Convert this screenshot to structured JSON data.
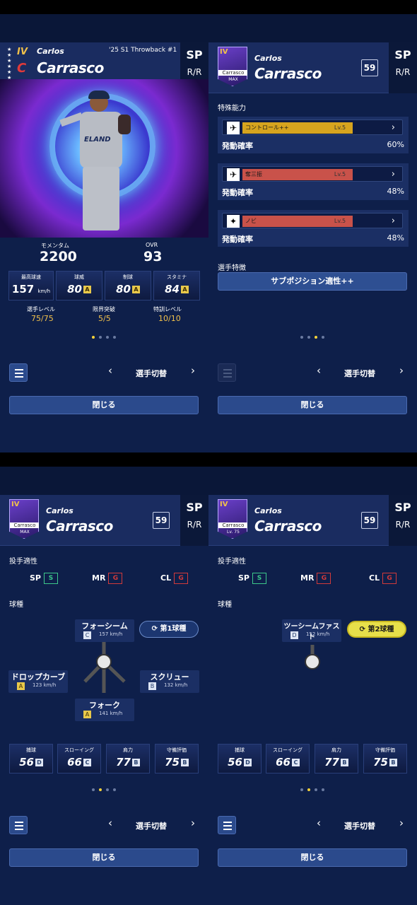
{
  "player": {
    "first_name": "Carlos",
    "last_name": "Carrasco",
    "position": "SP",
    "hand": "R/R",
    "number": "59",
    "tier": "IV",
    "card_title": "'25 S1 Throwback #1"
  },
  "thumb": {
    "name": "Carrasco",
    "status_max": "MAX",
    "status_lv": "Lv. 75"
  },
  "panel1": {
    "momentum_label": "モメンタム",
    "momentum": "2200",
    "ovr_label": "OVR",
    "ovr": "93",
    "stats": [
      {
        "label": "最高球速",
        "value": "157",
        "unit": "km/h",
        "grade": ""
      },
      {
        "label": "球威",
        "value": "80",
        "grade": "A"
      },
      {
        "label": "制球",
        "value": "80",
        "grade": "A"
      },
      {
        "label": "スタミナ",
        "value": "84",
        "grade": "A"
      }
    ],
    "level_label": "選手レベル",
    "level": "75/75",
    "limit_label": "限界突破",
    "limit": "5/5",
    "training_label": "特訓レベル",
    "training": "10/10"
  },
  "panel2": {
    "special_title": "特殊能力",
    "abilities": [
      {
        "name": "コントロール++",
        "lv": "Lv.5",
        "prob_label": "発動確率",
        "prob": "60%",
        "color": "#d7a41e"
      },
      {
        "name": "奪三振",
        "lv": "Lv.5",
        "prob_label": "発動確率",
        "prob": "48%",
        "color": "#c9524a"
      },
      {
        "name": "ノビ",
        "lv": "Lv.5",
        "prob_label": "発動確率",
        "prob": "48%",
        "color": "#c9524a"
      }
    ],
    "trait_title": "選手特徴",
    "trait": "サブポジション適性++"
  },
  "aptitude": {
    "title": "投手適性",
    "items": [
      {
        "pos": "SP",
        "grade": "S"
      },
      {
        "pos": "MR",
        "grade": "G"
      },
      {
        "pos": "CL",
        "grade": "G"
      }
    ]
  },
  "pitch_title": "球種",
  "panel3_pitches": [
    {
      "name": "フォーシーム",
      "grade": "C",
      "speed": "157 km/h"
    },
    {
      "name": "ドロップカーブ",
      "grade": "A",
      "speed": "123 km/h"
    },
    {
      "name": "スクリュー",
      "grade": "B",
      "speed": "132 km/h"
    },
    {
      "name": "フォーク",
      "grade": "A",
      "speed": "141 km/h"
    }
  ],
  "panel3_pill": "第1球種",
  "panel4_pitches": [
    {
      "name": "ツーシームファスト",
      "grade": "D",
      "speed": "152 km/h"
    }
  ],
  "panel4_pill": "第2球種",
  "fielding": [
    {
      "label": "捕球",
      "value": "56",
      "grade": "D"
    },
    {
      "label": "スローイング",
      "value": "66",
      "grade": "C"
    },
    {
      "label": "肩力",
      "value": "77",
      "grade": "B"
    },
    {
      "label": "守備評価",
      "value": "75",
      "grade": "B"
    }
  ],
  "nav": {
    "switch": "選手切替",
    "close": "閉じる",
    "prev": "‹",
    "next": "›"
  }
}
